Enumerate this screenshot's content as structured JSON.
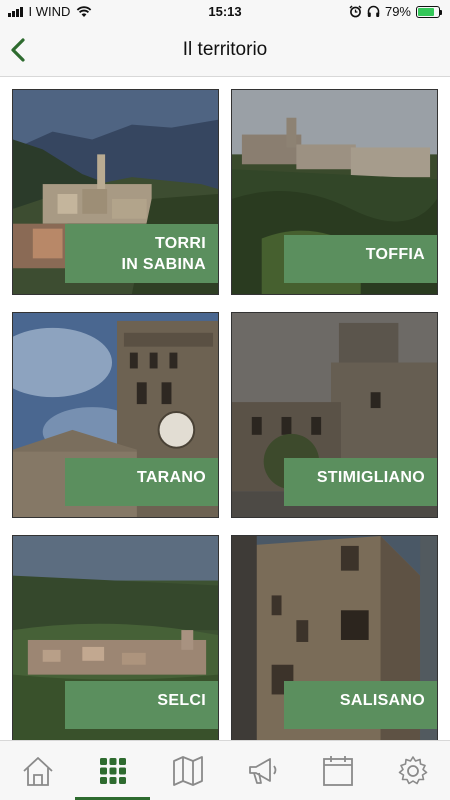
{
  "status_bar": {
    "carrier": "I WIND",
    "time": "15:13",
    "battery": "79%",
    "battery_level": 0.79
  },
  "header": {
    "title": "Il territorio"
  },
  "tiles": [
    {
      "label": "TORRI\nIN SABINA"
    },
    {
      "label": "TOFFIA"
    },
    {
      "label": "TARANO"
    },
    {
      "label": "STIMIGLIANO"
    },
    {
      "label": "SELCI"
    },
    {
      "label": "SALISANO"
    }
  ],
  "tabbar": {
    "tabs": [
      {
        "icon": "home-icon",
        "active": false
      },
      {
        "icon": "grid-icon",
        "active": true
      },
      {
        "icon": "map-icon",
        "active": false
      },
      {
        "icon": "megaphone-icon",
        "active": false
      },
      {
        "icon": "calendar-icon",
        "active": false
      },
      {
        "icon": "gear-icon",
        "active": false
      }
    ]
  },
  "colors": {
    "accent": "#2e6b2f",
    "label_bg": "#5b8f5e",
    "icon_inactive": "#8a8a8a"
  }
}
